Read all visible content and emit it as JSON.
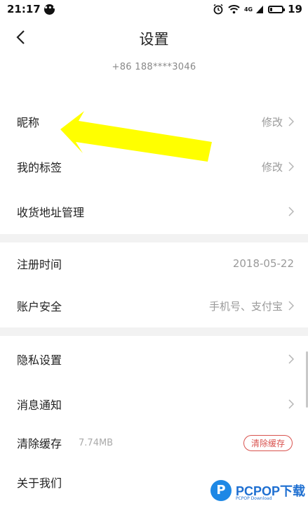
{
  "status": {
    "time": "21:17",
    "network": "4G",
    "battery": "19",
    "battery_level": 0.19,
    "chat_icon": "chat-bubble-icon"
  },
  "nav": {
    "title": "设置",
    "back_icon": "chevron-left-icon"
  },
  "account": {
    "phone": "+86 188****3046"
  },
  "section1": [
    {
      "label": "昵称",
      "value": "修改"
    },
    {
      "label": "我的标签",
      "value": "修改"
    },
    {
      "label": "收货地址管理",
      "value": ""
    }
  ],
  "section2": [
    {
      "label": "注册时间",
      "value": "2018-05-22"
    },
    {
      "label": "账户安全",
      "value": "手机号、支付宝"
    }
  ],
  "section3": [
    {
      "label": "隐私设置"
    },
    {
      "label": "消息通知"
    },
    {
      "label": "清除缓存",
      "sub": "7.74MB",
      "button": "清除缓存"
    },
    {
      "label": "关于我们"
    }
  ],
  "overlay": {
    "arrow_color": "#ffff00"
  },
  "watermark": {
    "logo": "P",
    "text": "PCPOP下载",
    "sub": "PCPOP Download"
  },
  "colors": {
    "accent_red": "#d9534f",
    "divider": "#f2f2f2"
  }
}
